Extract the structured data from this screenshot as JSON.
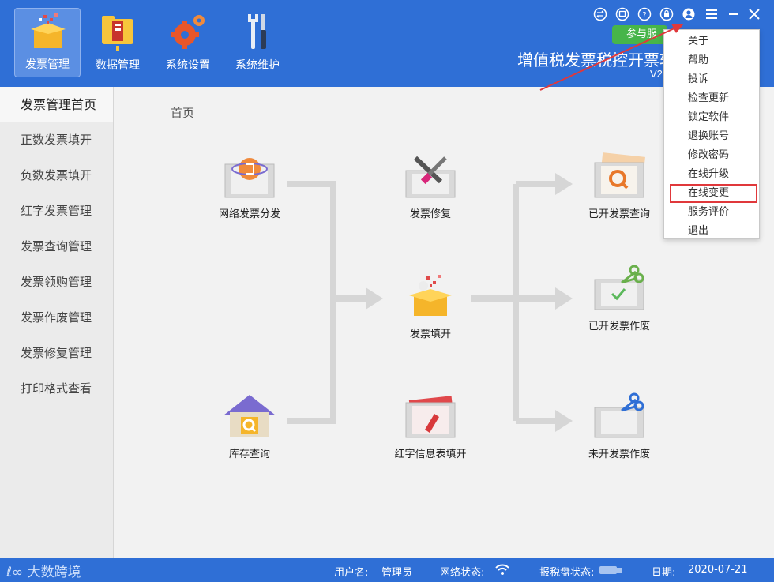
{
  "topnav": [
    {
      "label": "发票管理",
      "icon": "invoice-box-icon",
      "active": true
    },
    {
      "label": "数据管理",
      "icon": "data-folder-icon",
      "active": false
    },
    {
      "label": "系统设置",
      "icon": "settings-gear-icon",
      "active": false
    },
    {
      "label": "系统维护",
      "icon": "maintenance-tools-icon",
      "active": false
    }
  ],
  "header": {
    "title": "增值税发票税控开票软",
    "version": "V2",
    "promo_button": "参与服"
  },
  "sidebar": {
    "items": [
      {
        "label": "发票管理首页",
        "active": true
      },
      {
        "label": "正数发票填开"
      },
      {
        "label": "负数发票填开"
      },
      {
        "label": "红字发票管理"
      },
      {
        "label": "发票查询管理"
      },
      {
        "label": "发票领购管理"
      },
      {
        "label": "发票作废管理"
      },
      {
        "label": "发票修复管理"
      },
      {
        "label": "打印格式查看"
      }
    ]
  },
  "main": {
    "breadcrumb": "首页",
    "tiles": {
      "distribute": "网络发票分发",
      "repair": "发票修复",
      "issued_query": "已开发票查询",
      "fill": "发票填开",
      "issued_void": "已开发票作废",
      "inventory": "库存查询",
      "red_info": "红字信息表填开",
      "blank_void": "未开发票作废"
    }
  },
  "menu": {
    "items": [
      "关于",
      "帮助",
      "投诉",
      "检查更新",
      "锁定软件",
      "退换账号",
      "修改密码",
      "在线升级",
      "在线变更",
      "服务评价",
      "退出"
    ],
    "highlighted": "在线变更"
  },
  "statusbar": {
    "brand": "大数跨境",
    "user_label": "用户名:",
    "user_value": "管理员",
    "network_label": "网络状态:",
    "disk_label": "报税盘状态:",
    "date_label": "日期:",
    "date_value": "2020-07-21"
  },
  "colors": {
    "header_blue": "#2f6fd6",
    "highlight_red": "#e0383b",
    "green_button": "#47b54a"
  }
}
